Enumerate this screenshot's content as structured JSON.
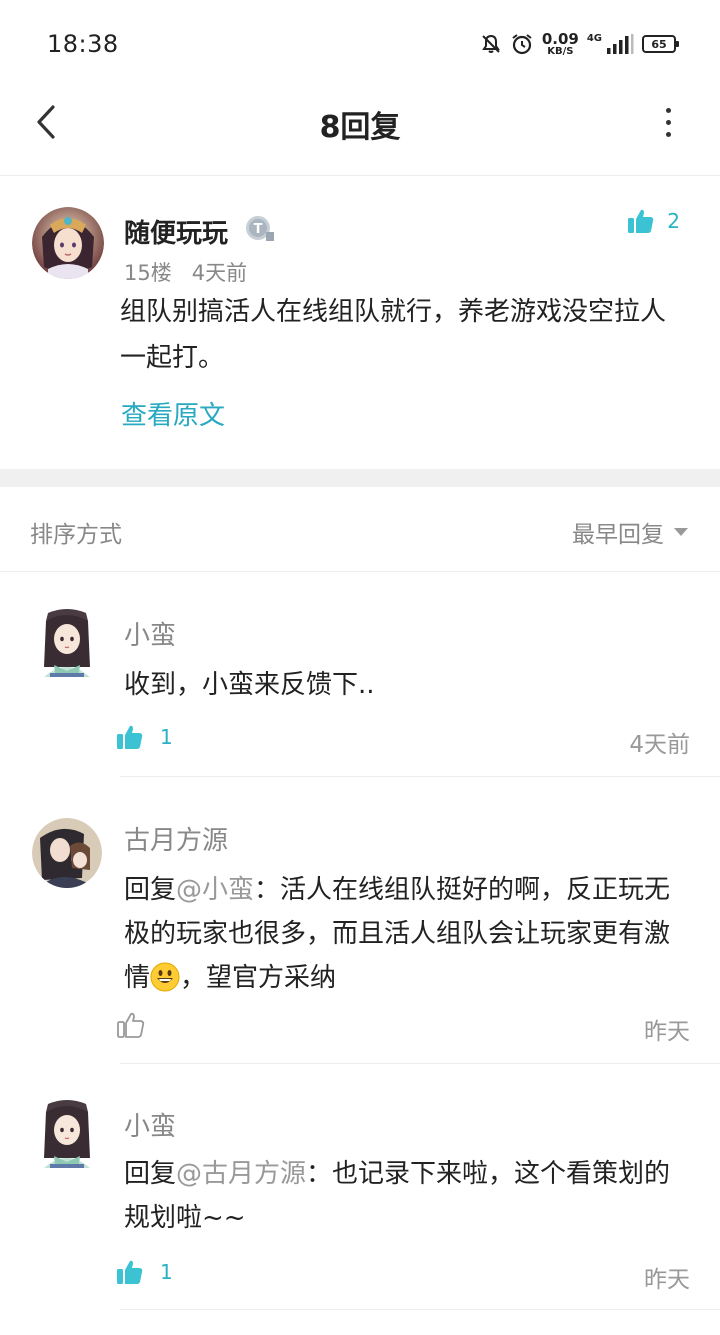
{
  "status_bar": {
    "time": "18:38",
    "net_speed_value": "0.09",
    "net_speed_unit": "KB/S",
    "network_type": "4G",
    "battery": "65",
    "icons": [
      "mute-bell-icon",
      "alarm-icon",
      "signal-icon",
      "battery-icon"
    ]
  },
  "header": {
    "title": "8回复",
    "back_icon": "chevron-left-icon",
    "more_icon": "more-vertical-icon"
  },
  "post": {
    "author": "随便玩玩",
    "badge_letter": "T",
    "floor": "15楼",
    "time": "4天前",
    "likes": "2",
    "liked": true,
    "content": "组队别搞活人在线组队就行，养老游戏没空拉人一起打。",
    "view_original_label": "查看原文"
  },
  "sort": {
    "label": "排序方式",
    "selected": "最早回复"
  },
  "replies": [
    {
      "author": "小蛮",
      "mention": "",
      "text": "收到，小蛮来反馈下..",
      "likes": "1",
      "liked": true,
      "time": "4天前"
    },
    {
      "author": "古月方源",
      "prefix": "回复",
      "mention": "@小蛮",
      "text": "：活人在线组队挺好的啊，反正玩无极的玩家也很多，而且活人组队会让玩家更有激情",
      "emoji": "grinning-face-emoji",
      "text_after": "，望官方采纳",
      "likes": "",
      "liked": false,
      "time": "昨天"
    },
    {
      "author": "小蛮",
      "prefix": "回复",
      "mention": "@古月方源",
      "text": "：也记录下来啦，这个看策划的规划啦~~",
      "likes": "1",
      "liked": true,
      "time": "昨天"
    }
  ],
  "colors": {
    "accent": "#27a9c0",
    "like_fill": "#3cc3d3",
    "muted": "#888888",
    "divider": "#ececec",
    "gap": "#f0f0f0"
  }
}
